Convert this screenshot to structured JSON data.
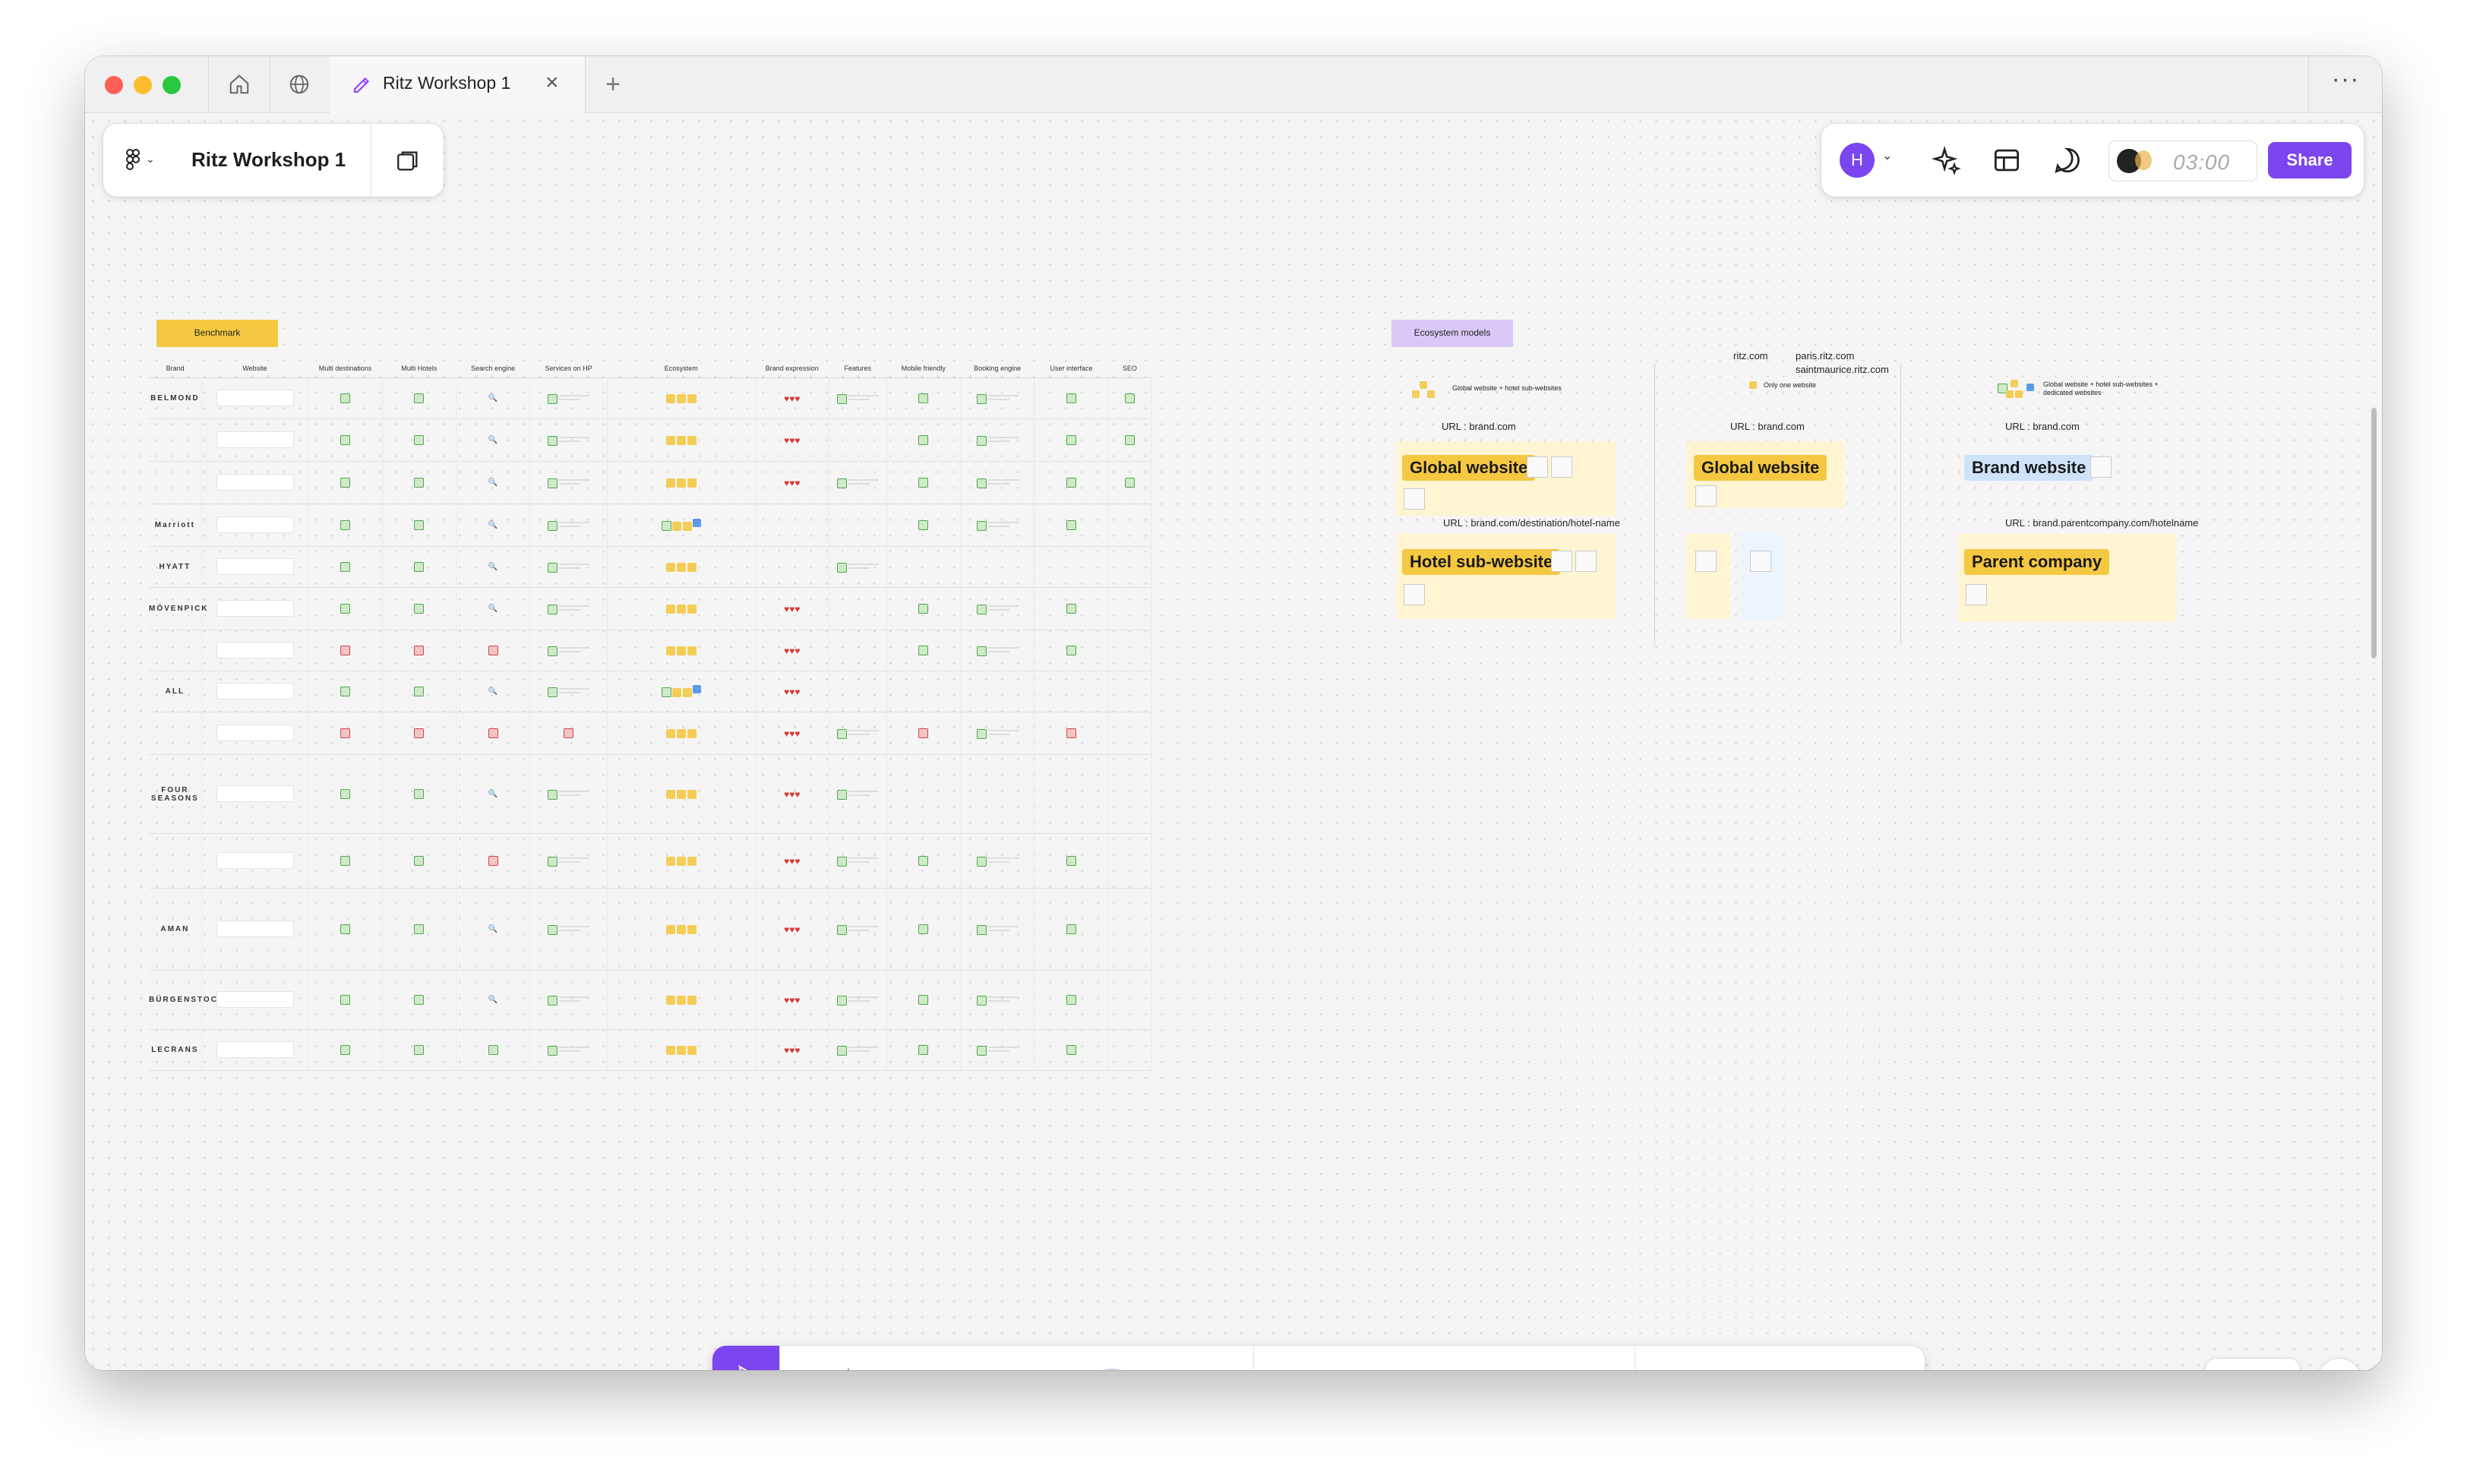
{
  "window": {
    "tab_title": "Ritz Workshop 1"
  },
  "header": {
    "file_name": "Ritz Workshop 1",
    "avatar_initial": "H",
    "timer": "03:00",
    "share_label": "Share"
  },
  "benchmark": {
    "section_label": "Benchmark",
    "columns": [
      "Brand",
      "Website",
      "Multi destinations",
      "Multi Hotels",
      "Search engine",
      "Services on HP",
      "Ecosystem",
      "Brand expression",
      "Features",
      "Mobile friendly",
      "Booking engine",
      "User interface",
      "SEO"
    ],
    "brands": [
      "BELMOND",
      "",
      "",
      "Marriott",
      "HYATT",
      "MÖVENPICK",
      "",
      "ALL",
      "",
      "FOUR SEASONS",
      "",
      "AMAN",
      "BÜRGENSTOCK",
      "LECRANS"
    ]
  },
  "ecosystem": {
    "section_label": "Ecosystem models",
    "models": [
      {
        "legend": "Global website + hotel sub-websites",
        "url_top": "URL : brand.com",
        "main_label": "Global website",
        "url_sub": "URL : brand.com/destination/hotel-name",
        "sub_label": "Hotel sub-website"
      },
      {
        "domains": [
          "ritz.com",
          "paris.ritz.com",
          "saintmaurice.ritz.com"
        ],
        "legend": "Only one website",
        "url_top": "URL : brand.com",
        "main_label": "Global website"
      },
      {
        "legend": "Global website + hotel sub-websites + dedicated websites",
        "url_top": "URL : brand.com",
        "main_label": "Brand website",
        "url_sub": "URL : brand.parentcompany.com/hotelname",
        "sub_label": "Parent company"
      }
    ]
  },
  "colors": {
    "accent": "#7b45f0",
    "sticky_yellow": "#f5c842",
    "sticky_purple": "#d9c9f7",
    "chip_yellow": "#f5c842",
    "chip_blue": "#cfe3f8"
  },
  "toolbar": {
    "tools": [
      "move",
      "hand",
      "pen",
      "sticky-note",
      "shapes",
      "text",
      "section",
      "table",
      "stamp",
      "widgets",
      "more"
    ]
  }
}
